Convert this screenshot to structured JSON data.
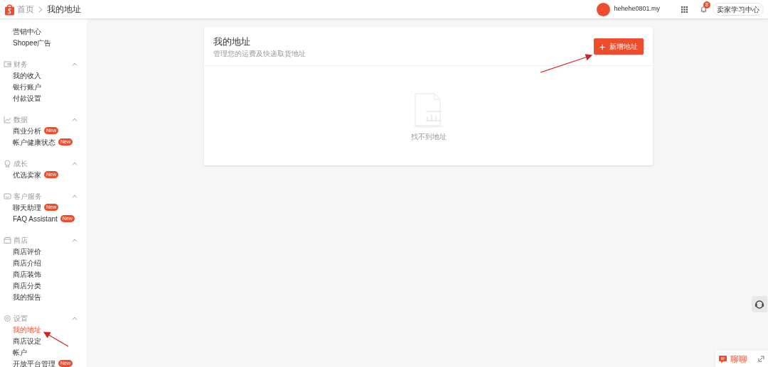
{
  "topbar": {
    "breadcrumb": [
      {
        "label": "首页"
      },
      {
        "label": "我的地址"
      }
    ],
    "username": "hehehe0801.my",
    "notification_count": "8",
    "learning_button": "卖家学习中心"
  },
  "sidebar": {
    "sections": [
      {
        "items": [
          {
            "label": "营销中心",
            "selected": false
          },
          {
            "label": "Shopee广告",
            "selected": false
          }
        ]
      },
      {
        "title": "财务",
        "expanded": true,
        "items": [
          {
            "label": "我的收入",
            "selected": false
          },
          {
            "label": "银行账户",
            "selected": false
          },
          {
            "label": "付款设置",
            "selected": false
          }
        ]
      },
      {
        "title": "数据",
        "expanded": true,
        "items": [
          {
            "label": "商业分析",
            "badge": "New",
            "selected": false
          },
          {
            "label": "帐户健康状态",
            "badge": "New",
            "selected": false
          }
        ]
      },
      {
        "title": "成长",
        "expanded": true,
        "items": [
          {
            "label": "优选卖家",
            "badge": "New",
            "selected": false
          }
        ]
      },
      {
        "title": "客户服务",
        "expanded": true,
        "items": [
          {
            "label": "聊天助理",
            "badge": "New",
            "selected": false
          },
          {
            "label": "FAQ Assistant",
            "badge": "New",
            "selected": false
          }
        ]
      },
      {
        "title": "商店",
        "expanded": true,
        "items": [
          {
            "label": "商店评价",
            "selected": false
          },
          {
            "label": "商店介绍",
            "selected": false
          },
          {
            "label": "商店装饰",
            "selected": false
          },
          {
            "label": "商店分类",
            "selected": false
          },
          {
            "label": "我的报告",
            "selected": false
          }
        ]
      },
      {
        "title": "设置",
        "expanded": true,
        "items": [
          {
            "label": "我的地址",
            "selected": true
          },
          {
            "label": "商店设定",
            "selected": false
          },
          {
            "label": "帐户",
            "selected": false
          },
          {
            "label": "开放平台管理",
            "badge": "New",
            "selected": false
          }
        ]
      }
    ]
  },
  "main": {
    "title": "我的地址",
    "subtitle": "管理您的运费及快递取货地址",
    "add_button": {
      "icon": "+",
      "label": "新增地址"
    },
    "empty_text": "找不到地址"
  },
  "chat": {
    "label": "聊聊"
  }
}
